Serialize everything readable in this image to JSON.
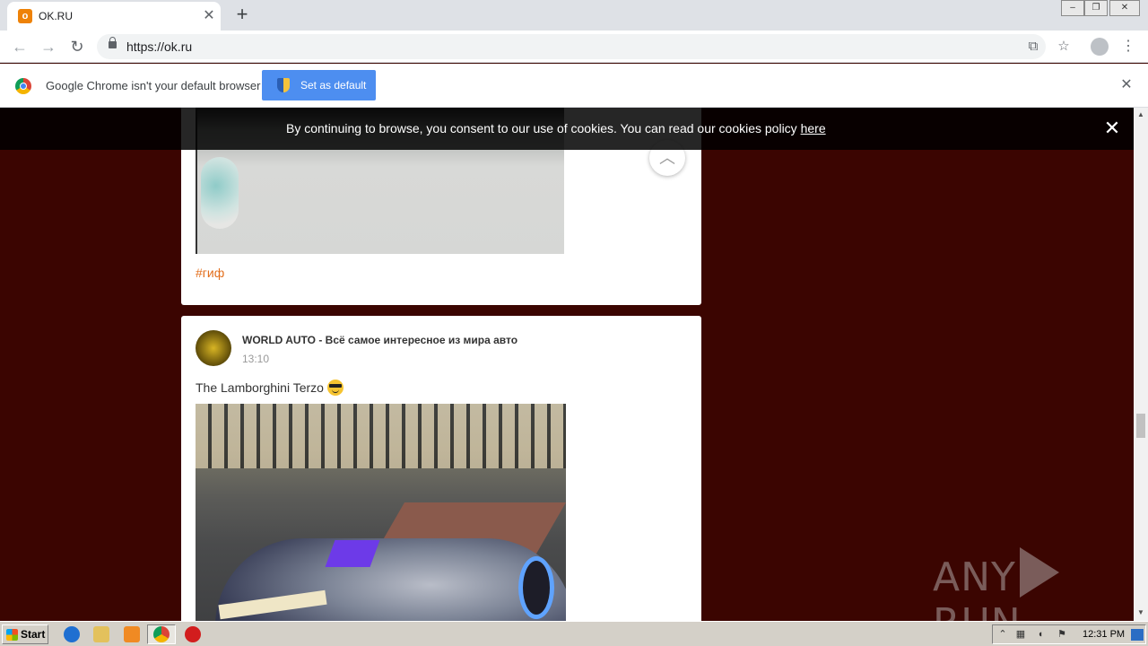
{
  "browser": {
    "tab_title": "OK.RU",
    "tab_favicon": "ok",
    "url": "https://ok.ru",
    "new_tab_icon": "+",
    "tab_close_icon": "✕"
  },
  "infobar": {
    "message": "Google Chrome isn't your default browser",
    "button_label": "Set as default",
    "close_icon": "✕"
  },
  "cookie_banner": {
    "text": "By continuing to browse, you consent to our use of cookies. You can read our cookies policy",
    "link": "here",
    "close_icon": "✕"
  },
  "feed": {
    "post1": {
      "hashtag": "#гиф"
    },
    "post2": {
      "author": "WORLD AUTO - Всё самое интересное из мира авто",
      "time": "13:10",
      "text": "The Lamborghini Terzo"
    }
  },
  "watermark": {
    "left": "ANY",
    "right": "RUN"
  },
  "taskbar": {
    "start_label": "Start",
    "clock": "12:31 PM"
  },
  "colors": {
    "page_background": "#3b0501",
    "hashtag": "#e36f1d",
    "set_default_button": "#4d8ef0"
  }
}
